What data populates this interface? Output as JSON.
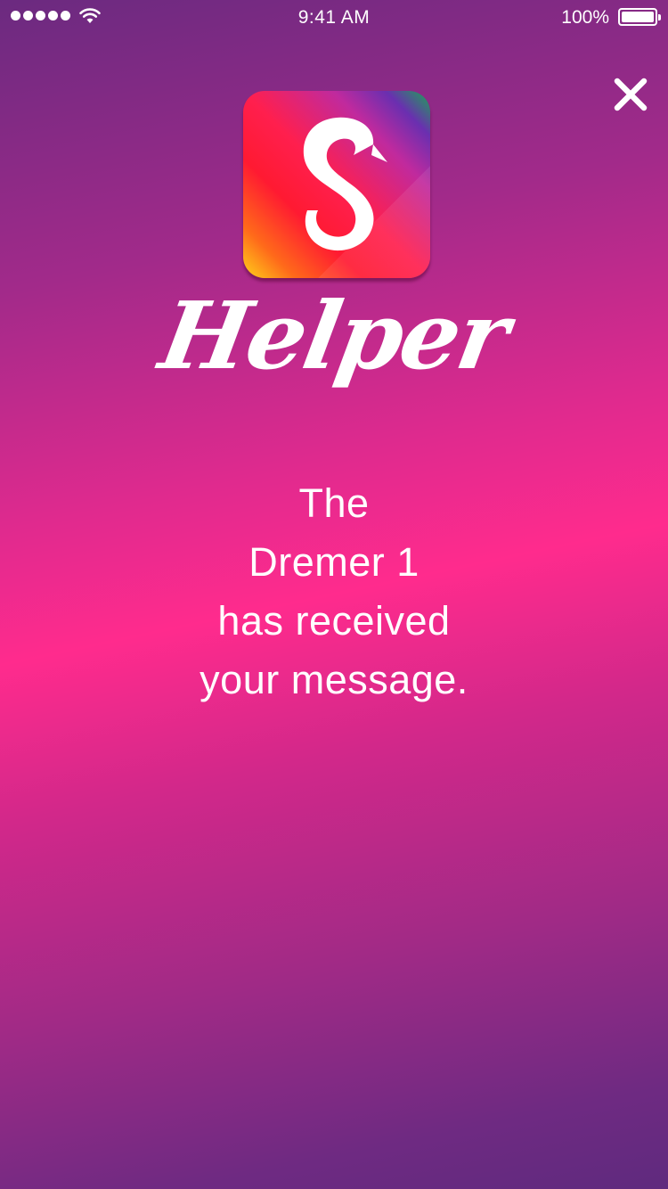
{
  "status_bar": {
    "time": "9:41 AM",
    "battery_percent": "100%",
    "signal_bars": 5,
    "battery_level": 1.0
  },
  "header": {
    "close_icon": "close-icon",
    "app_icon": "app-logo-s-icon",
    "app_icon_letter": "S",
    "title": "Helper"
  },
  "message": {
    "lines": [
      "The",
      "Dremer 1",
      "has received",
      "your message."
    ]
  },
  "colors": {
    "background_top": "#6b2a80",
    "background_mid": "#ff2b8d",
    "background_bottom": "#5f2a7e",
    "text": "#ffffff"
  }
}
